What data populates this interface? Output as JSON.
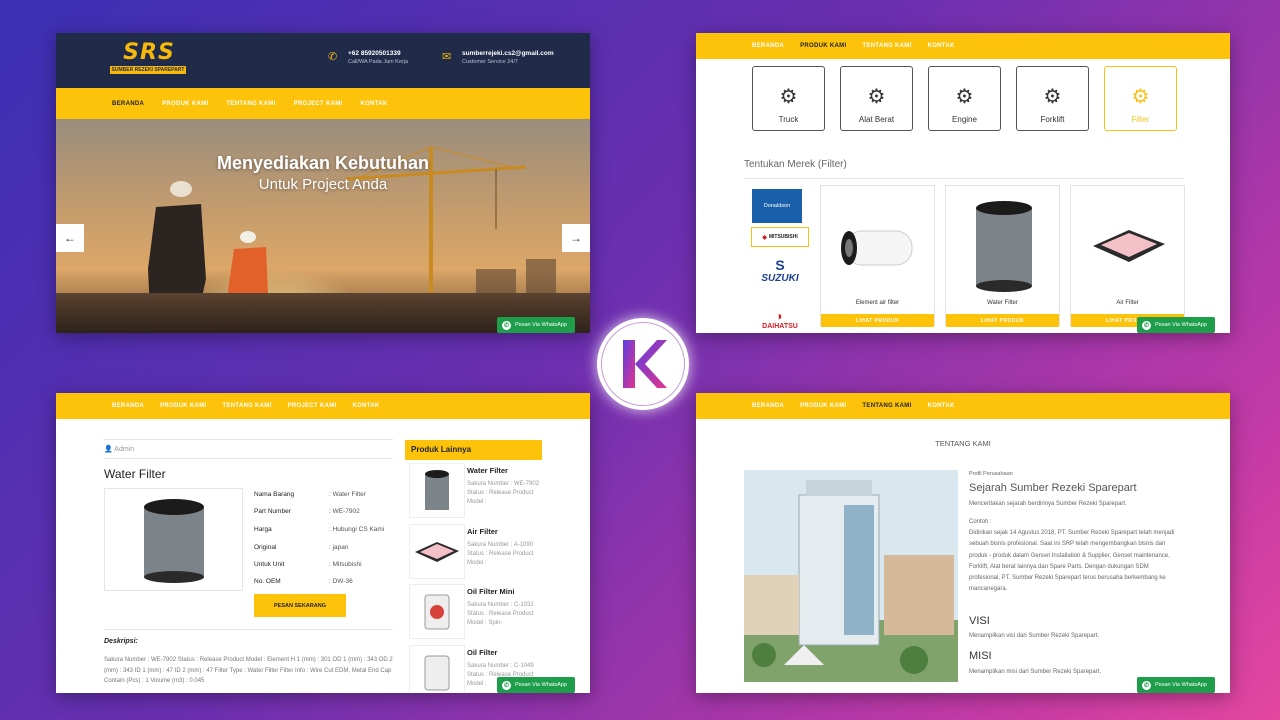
{
  "nav": {
    "beranda": "BERANDA",
    "produk": "PRODUK KAMI",
    "tentang": "TENTANG KAMI",
    "project": "PROJECT KAMI",
    "kontak": "KONTAK"
  },
  "whatsapp_label": "Pesan Via WhatsApp",
  "home": {
    "logo_mark": [
      "S",
      "R",
      "S"
    ],
    "logo_sub": "SUMBER REZEKI SPAREPART",
    "phone": "+62 85920501339",
    "phone_sub": "Call/WA Pada Jam Kerja",
    "email": "sumberrejeki.cs2@gmail.com",
    "email_sub": "Customer Service 24/7",
    "hero_title": "Menyediakan Kebutuhan",
    "hero_sub": "Untuk Project Anda"
  },
  "products_page": {
    "categories": [
      "Truck",
      "Alat Berat",
      "Engine",
      "Forklift",
      "Filter"
    ],
    "active_category": "Filter",
    "brand_title": "Tentukan Merek (Filter)",
    "brands": [
      "Donaldson",
      "MITSUBISHI",
      "SUZUKI",
      "DAIHATSU"
    ],
    "products": [
      "Element air filter",
      "Water Filter",
      "Air Filter"
    ],
    "view_button": "LIHAT PRODUK"
  },
  "detail": {
    "author": "Admin",
    "title": "Water Filter",
    "specs": [
      {
        "label": "Nama Barang",
        "value": ": Water Filter"
      },
      {
        "label": "Part Number",
        "value": ": WE-7902"
      },
      {
        "label": "Harga",
        "value": ": Hubungi CS Kami"
      },
      {
        "label": "Original",
        "value": ": japan"
      },
      {
        "label": "Untuk Unit",
        "value": ": Mitsubishi"
      },
      {
        "label": "No. OEM",
        "value": ": DW-36"
      }
    ],
    "order_button": "PESAN SEKARANG",
    "desc_heading": "Deskripsi:",
    "desc_text": "Sakura Number : WE-7902 Status : Release Product Model : Element H 1 (mm) : 301 OD 1 (mm) : 343 OD 2 (mm) : 343 ID 1 (mm) : 47 ID 2 (mm) : 47 Filter Type : Water Filter Filter Info : Wire Cut EDM, Metal End Cap Contain (Pcs) : 1 Volume (m3) : 0.045",
    "side_heading": "Produk Lainnya",
    "others": [
      {
        "name": "Water Filter",
        "desc": "Sakura Number : WE-7902 Status : Release Product Model :"
      },
      {
        "name": "Air Filter",
        "desc": "Sakura Number : A-1090 Status : Release Product Model :"
      },
      {
        "name": "Oil Filter Mini",
        "desc": "Sakura Number : C-1032 Status : Release Product Model : Spin-"
      },
      {
        "name": "Oil Filter",
        "desc": "Sakura Number : C-1049 Status : Release Product Model :"
      }
    ]
  },
  "about": {
    "heading": "TENTANG KAMI",
    "small_label": "Profil Perusahaan",
    "title": "Sejarah Sumber Rezeki Sparepart",
    "intro": "Menceritakan sejarah berdirinya Sumber Rezeki Sparepart.",
    "contoh_label": "Contoh :",
    "history": "Didirikan sejak 14 Agustus 2018, PT. Sumber Rezeki Sparepart telah menjadi sebuah bisnis profesional. Saat ini SRP telah mengembangkan bisnis dan produk - produk dalam Genset Installation & Supplier, Genset maintenance, Forklift, Alat berat lainnya dan Spare Parts. Dengan dukungan SDM profesional, PT. Sumber Rezeki Sparepart terus berusaha berkembang ke mancanegara.",
    "visi_heading": "VISI",
    "visi_text": "Menampilkan visi dari Sumber Rezeki Sparepart.",
    "misi_heading": "MISI",
    "misi_text": "Menampilkan misi dari Sumber Rezeki Sparepart."
  },
  "badge_letter": "K",
  "colors": {
    "accent": "#fcc30a",
    "navy": "#1f2b48",
    "whatsapp": "#1e9e4a"
  }
}
